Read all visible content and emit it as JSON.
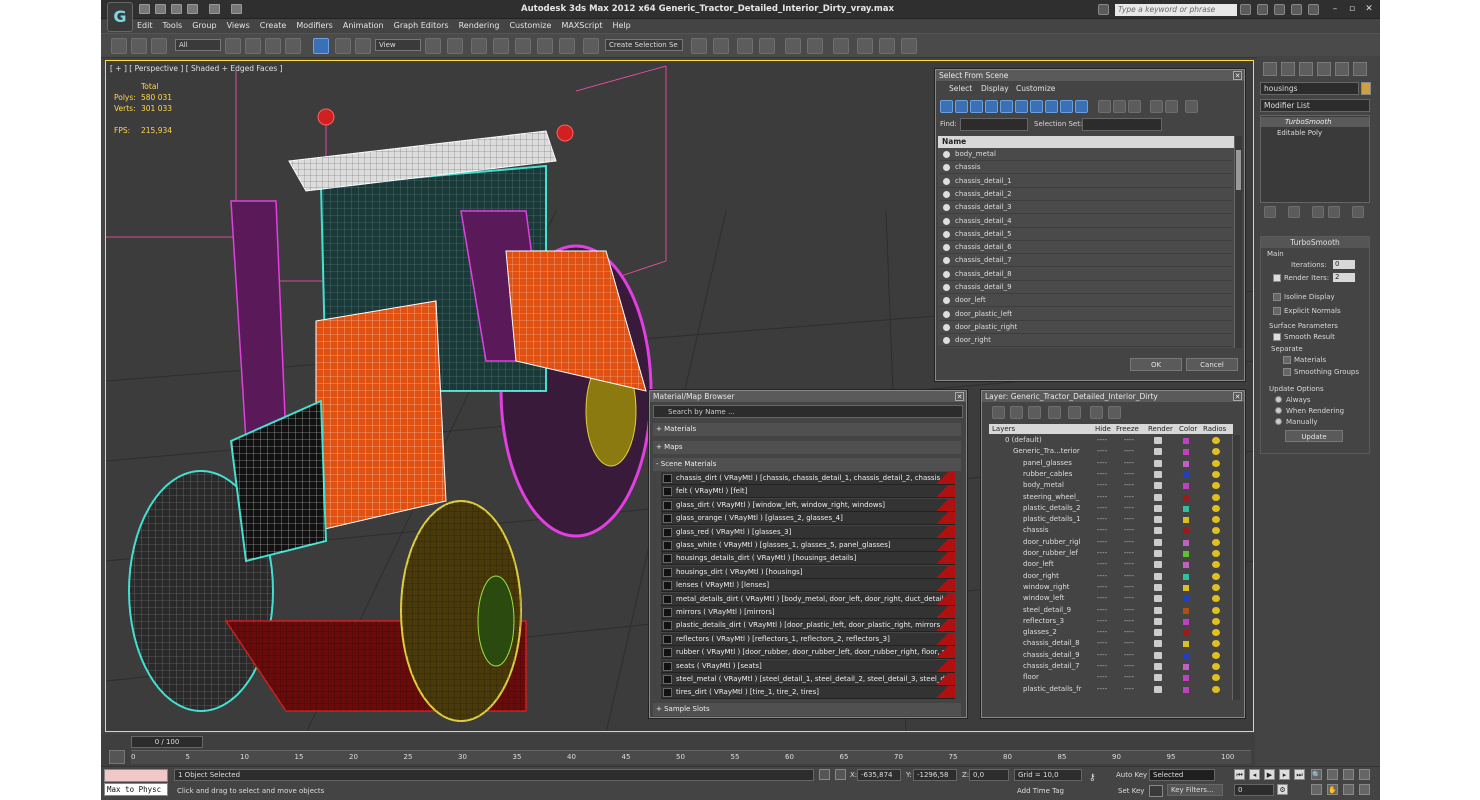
{
  "window": {
    "title": "Autodesk 3ds Max  2012 x64     Generic_Tractor_Detailed_Interior_Dirty_vray.max",
    "search_placeholder": "Type a keyword or phrase"
  },
  "menu": [
    "Edit",
    "Tools",
    "Group",
    "Views",
    "Create",
    "Modifiers",
    "Animation",
    "Graph Editors",
    "Rendering",
    "Customize",
    "MAXScript",
    "Help"
  ],
  "toolbar": {
    "selection_filter": "All",
    "reference_coord": "View",
    "named_selection": "Create Selection Se"
  },
  "viewport": {
    "label": "[ + ] [ Perspective ] [ Shaded + Edged Faces ]",
    "stats_total": "Total",
    "polys_label": "Polys:",
    "polys_value": "580 031",
    "verts_label": "Verts:",
    "verts_value": "301 033",
    "fps_label": "FPS:",
    "fps_value": "215,934"
  },
  "select_from_scene": {
    "title": "Select From Scene",
    "menu": [
      "Select",
      "Display",
      "Customize"
    ],
    "find_label": "Find:",
    "selection_set_label": "Selection Set:",
    "column": "Name",
    "items": [
      "body_metal",
      "chassis",
      "chassis_detail_1",
      "chassis_detail_2",
      "chassis_detail_3",
      "chassis_detail_4",
      "chassis_detail_5",
      "chassis_detail_6",
      "chassis_detail_7",
      "chassis_detail_8",
      "chassis_detail_9",
      "door_left",
      "door_plastic_left",
      "door_plastic_right",
      "door_right"
    ],
    "ok": "OK",
    "cancel": "Cancel"
  },
  "material_browser": {
    "title": "Material/Map Browser",
    "search_placeholder": "Search by Name ...",
    "sections": [
      "+ Materials",
      "+ Maps",
      "- Scene Materials"
    ],
    "materials": [
      "chassis_dirt ( VRayMtl ) [chassis, chassis_detail_1, chassis_detail_2, chassis_de...",
      "felt ( VRayMtl ) [felt]",
      "glass_dirt ( VRayMtl ) [window_left, window_right, windows]",
      "glass_orange ( VRayMtl ) [glasses_2, glasses_4]",
      "glass_red ( VRayMtl ) [glasses_3]",
      "glass_white ( VRayMtl ) [glasses_1, glasses_5, panel_glasses]",
      "housings_details_dirt ( VRayMtl ) [housings_details]",
      "housings_dirt ( VRayMtl ) [housings]",
      "lenses ( VRayMtl ) [lenses]",
      "metal_details_dirt ( VRayMtl ) [body_metal, door_left, door_right, duct_detail, l...",
      "mirrors ( VRayMtl ) [mirrors]",
      "plastic_details_dirt ( VRayMtl ) [door_plastic_left, door_plastic_right, mirrors_pl...",
      "reflectors ( VRayMtl ) [reflectors_1, reflectors_2, reflectors_3]",
      "rubber ( VRayMtl ) [door_rubber, door_rubber_left, door_rubber_right, floor, ru...",
      "seats ( VRayMtl ) [seats]",
      "steel_metal ( VRayMtl ) [steel_detail_1, steel_detail_2, steel_detail_3, steel_det...",
      "tires_dirt ( VRayMtl ) [tire_1, tire_2, tires]"
    ],
    "sample_slots": "+ Sample Slots"
  },
  "layer_manager": {
    "title": "Layer: Generic_Tractor_Detailed_Interior_Dirty",
    "columns": [
      "Layers",
      "Hide",
      "Freeze",
      "Render",
      "Color",
      "Radios"
    ],
    "default_layer": "0 (default)",
    "group_layer": "Generic_Tra...terior",
    "layers": [
      {
        "name": "panel_glasses",
        "color": "#c060c0"
      },
      {
        "name": "rubber_cables",
        "color": "#2040c0"
      },
      {
        "name": "body_metal",
        "color": "#c040c0"
      },
      {
        "name": "steering_wheel_",
        "color": "#a01818"
      },
      {
        "name": "plastic_details_2",
        "color": "#30c0a0"
      },
      {
        "name": "plastic_details_1",
        "color": "#d8c020"
      },
      {
        "name": "chassis",
        "color": "#a01818"
      },
      {
        "name": "door_rubber_rigl",
        "color": "#c060c0"
      },
      {
        "name": "door_rubber_lef",
        "color": "#60c030"
      },
      {
        "name": "door_left",
        "color": "#c060c0"
      },
      {
        "name": "door_right",
        "color": "#30c0a0"
      },
      {
        "name": "window_right",
        "color": "#d8c020"
      },
      {
        "name": "window_left",
        "color": "#2040c0"
      },
      {
        "name": "steel_detail_9",
        "color": "#b05010"
      },
      {
        "name": "reflectors_3",
        "color": "#c040c0"
      },
      {
        "name": "glasses_2",
        "color": "#a01818"
      },
      {
        "name": "chassis_detail_8",
        "color": "#d8c020"
      },
      {
        "name": "chassis_detail_9",
        "color": "#2040c0"
      },
      {
        "name": "chassis_detail_7",
        "color": "#c060c0"
      },
      {
        "name": "floor",
        "color": "#c040c0"
      },
      {
        "name": "plastic_details_fr",
        "color": "#c040c0"
      }
    ]
  },
  "command_panel": {
    "object_name": "housings",
    "modifier_list": "Modifier List",
    "stack": [
      "TurboSmooth",
      "Editable Poly"
    ],
    "turbosmooth": {
      "title": "TurboSmooth",
      "main": "Main",
      "iterations_label": "Iterations:",
      "iterations": "0",
      "render_iters_label": "Render Iters:",
      "render_iters": "2",
      "isoline": "Isoline Display",
      "explicit": "Explicit Normals",
      "surface": "Surface Parameters",
      "smooth_result": "Smooth Result",
      "separate": "Separate",
      "materials": "Materials",
      "smoothing_groups": "Smoothing Groups",
      "update_options": "Update Options",
      "always": "Always",
      "when_rendering": "When Rendering",
      "manually": "Manually",
      "update": "Update"
    }
  },
  "timeline": {
    "frame": "0 / 100",
    "ticks": [
      "0",
      "5",
      "10",
      "15",
      "20",
      "25",
      "30",
      "35",
      "40",
      "45",
      "50",
      "55",
      "60",
      "65",
      "70",
      "75",
      "80",
      "85",
      "90",
      "95",
      "100"
    ]
  },
  "status": {
    "maxscript": "Max to Physc",
    "selected": "1 Object Selected",
    "prompt": "Click and drag to select and move objects",
    "x_label": "X:",
    "x": "-635,874",
    "y_label": "Y:",
    "y": "-1296,58",
    "z_label": "Z:",
    "z": "0,0",
    "grid": "Grid = 10,0",
    "add_time_tag": "Add Time Tag",
    "auto_key": "Auto Key",
    "set_key": "Set Key",
    "selected_dd": "Selected",
    "key_filters": "Key Filters...",
    "frame_field": "0"
  }
}
